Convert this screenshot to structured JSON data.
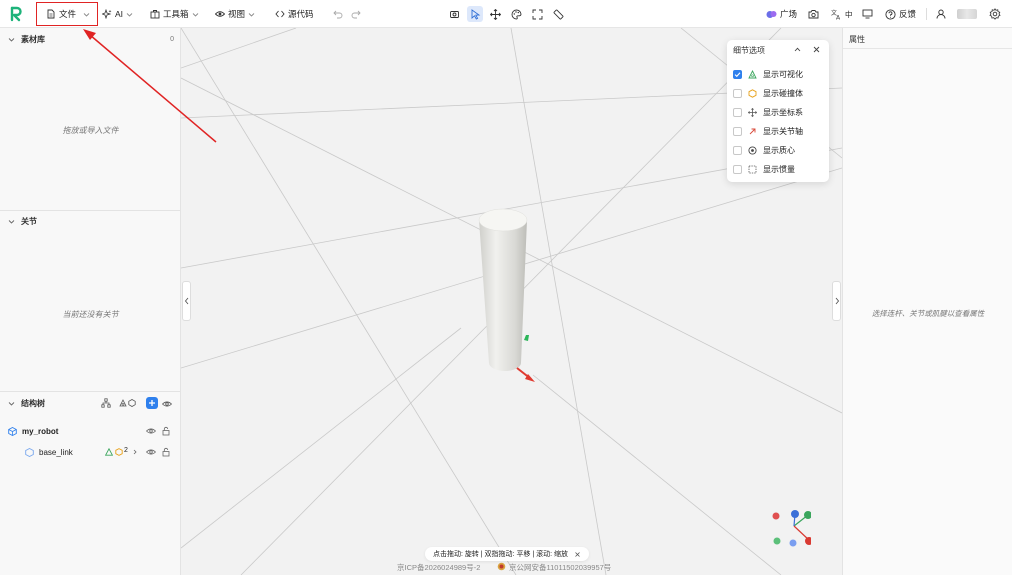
{
  "toolbar": {
    "file_label": "文件",
    "ai_label": "AI",
    "toolbox_label": "工具箱",
    "view_label": "视图",
    "source_label": "源代码",
    "square_label": "广场",
    "lang_label": "中",
    "feedback_label": "反馈"
  },
  "left": {
    "assets_title": "素材库",
    "assets_count": "0",
    "assets_empty": "拖放或导入文件",
    "joints_title": "关节",
    "joints_empty": "当前还没有关节",
    "tree_title": "结构树",
    "tree": {
      "root": "my_robot",
      "child": "base_link",
      "child_count": "2"
    }
  },
  "popup": {
    "title": "细节选项",
    "options": [
      {
        "label": "显示可视化",
        "checked": true
      },
      {
        "label": "显示碰撞体",
        "checked": false
      },
      {
        "label": "显示坐标系",
        "checked": false
      },
      {
        "label": "显示关节轴",
        "checked": false
      },
      {
        "label": "显示质心",
        "checked": false
      },
      {
        "label": "显示惯量",
        "checked": false
      }
    ]
  },
  "right": {
    "title": "属性",
    "empty": "选择连杆、关节或肌腱以查看属性"
  },
  "viewport": {
    "hint": "点击拖动: 旋转 | 双指拖动: 平移 | 滚动: 缩放"
  },
  "footer": {
    "icp": "京ICP备2026024989号-2",
    "police": "京公网安备11011502039957号"
  },
  "colors": {
    "accent": "#2f80ed",
    "annotation_red": "#e02424"
  }
}
